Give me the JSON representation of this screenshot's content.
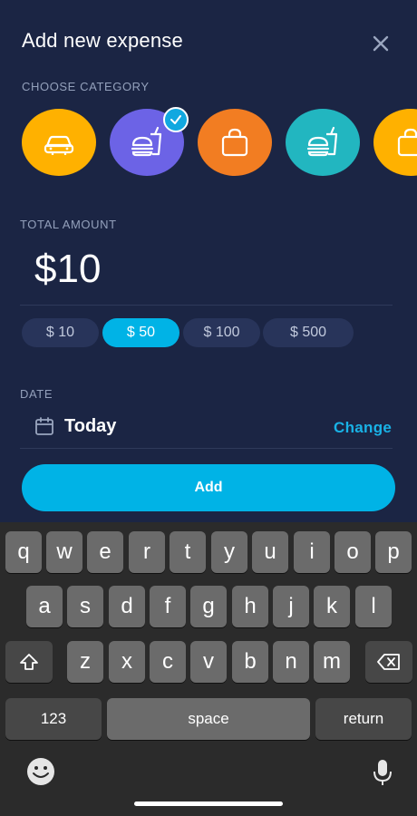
{
  "header": {
    "title": "Add new expense"
  },
  "category_section": {
    "label": "CHOOSE CATEGORY",
    "items": [
      {
        "icon": "car-icon",
        "color": "#ffb100",
        "selected": false
      },
      {
        "icon": "fast-food-icon",
        "color": "#6c63e6",
        "selected": true
      },
      {
        "icon": "shopping-bag-icon",
        "color": "#f27d22",
        "selected": false
      },
      {
        "icon": "fast-food-icon",
        "color": "#22b6c0",
        "selected": false
      },
      {
        "icon": "shopping-bag-icon",
        "color": "#ffb100",
        "selected": false
      }
    ]
  },
  "amount_section": {
    "label": "TOTAL AMOUNT",
    "value": "$10",
    "presets": [
      {
        "label": "$ 10",
        "selected": false
      },
      {
        "label": "$ 50",
        "selected": true
      },
      {
        "label": "$ 100",
        "selected": false
      },
      {
        "label": "$ 500",
        "selected": false
      }
    ]
  },
  "date_section": {
    "label": "DATE",
    "value": "Today",
    "change_label": "Change"
  },
  "add_button": {
    "label": "Add"
  },
  "keyboard": {
    "row1": [
      "q",
      "w",
      "e",
      "r",
      "t",
      "y",
      "u",
      "i",
      "o",
      "p"
    ],
    "row2": [
      "a",
      "s",
      "d",
      "f",
      "g",
      "h",
      "j",
      "k",
      "l"
    ],
    "row3": [
      "z",
      "x",
      "c",
      "v",
      "b",
      "n",
      "m"
    ],
    "numbers_label": "123",
    "space_label": "space",
    "return_label": "return"
  },
  "colors": {
    "background": "#1b2544",
    "accent": "#00b3e6"
  }
}
